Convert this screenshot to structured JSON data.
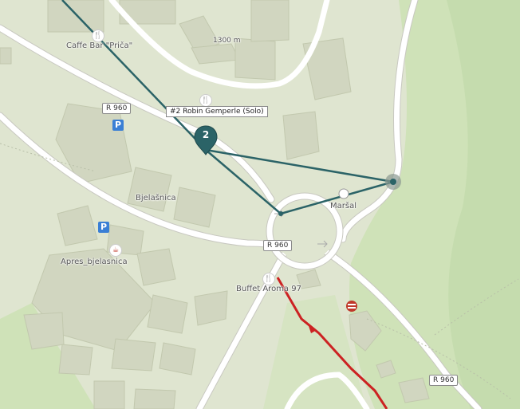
{
  "map": {
    "labels": {
      "caffe_bar": "Caffe Bar \"Priča\"",
      "elevation": "1300 m",
      "bjelasnica": "Bjelašnica",
      "apres": "Apres_bjelasnica",
      "marsal": "Maršal",
      "buffet": "Buffet Aroma 97"
    },
    "road_shields": [
      "R 960",
      "R 960",
      "R 960"
    ],
    "parking_symbol": "P",
    "track_marker": {
      "number": "2",
      "tooltip": "#2 Robin Gemperle (Solo)"
    },
    "colors": {
      "background": "#dfe5d0",
      "buildings": "#d1d6c0",
      "roads": "#ffffff",
      "track": "#2b6367",
      "route": "#cc2222",
      "parking": "#3a7fd5"
    }
  }
}
